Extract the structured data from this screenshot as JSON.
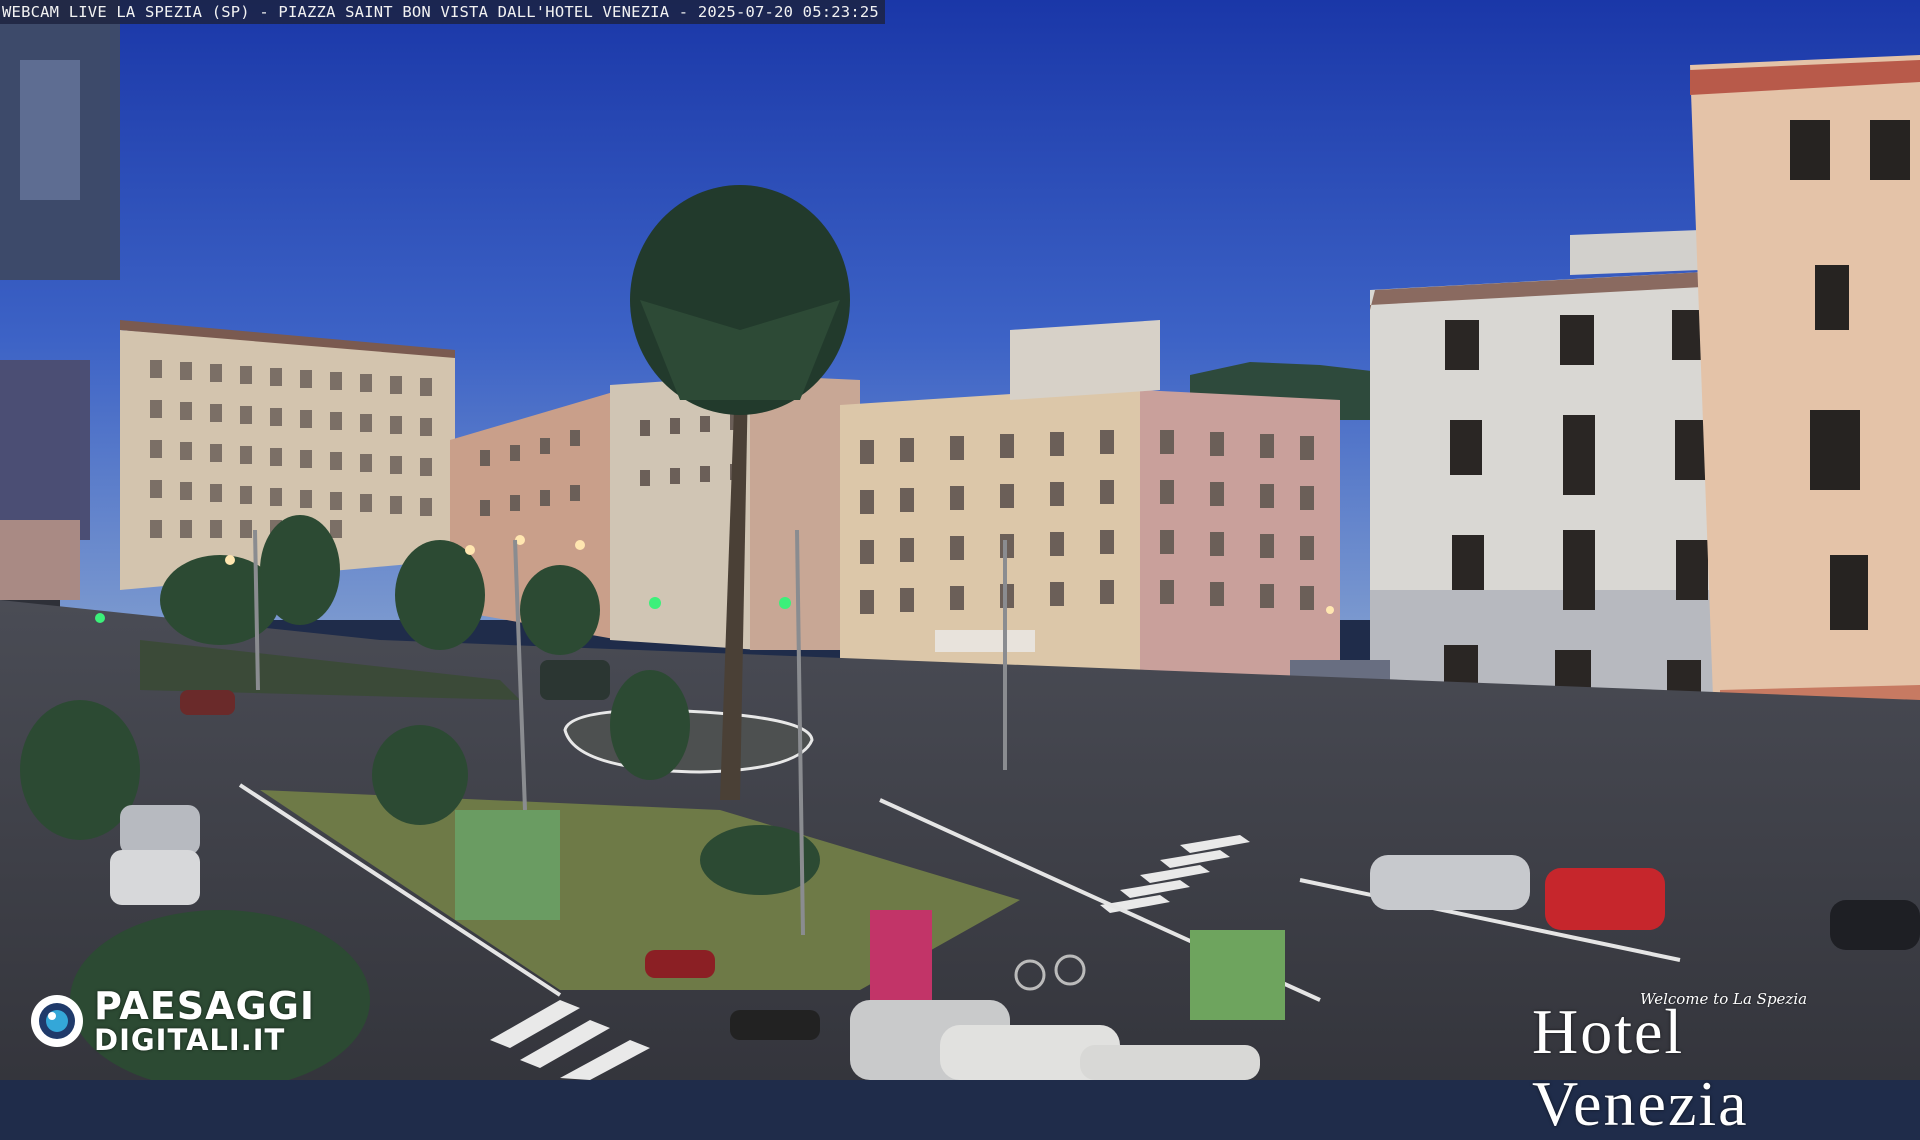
{
  "overlay": {
    "caption": "WEBCAM LIVE LA SPEZIA (SP) - PIAZZA SAINT BON VISTA DALL'HOTEL VENEZIA - 2025-07-20 05:23:25"
  },
  "logos": {
    "left_line1": "PAESAGGI",
    "left_line2": "DIGITALI.IT",
    "right_tagline": "Welcome to La Spezia",
    "right_name": "Hotel Venezia"
  },
  "colors": {
    "sky_top": "#1d3fb0",
    "sky_bottom": "#6a8cd0",
    "road": "#3b3c44",
    "grass": "#6f7a48",
    "building_cream": "#d2c3ac",
    "building_pink": "#c9a39a",
    "building_red": "#b8695a",
    "accent_white": "#ffffff"
  },
  "icons": {
    "left_logo_mark": "paesaggi-lens-icon"
  }
}
